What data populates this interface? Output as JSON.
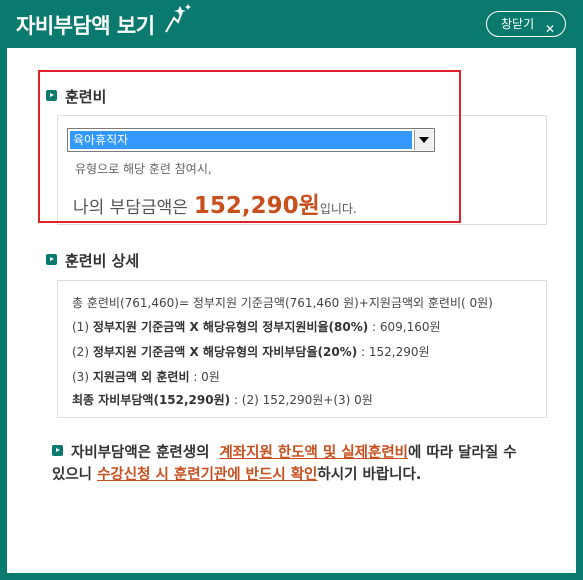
{
  "header": {
    "title": "자비부담액 보기",
    "close_label": "창닫기",
    "close_glyph": "✕"
  },
  "colors": {
    "brand": "#0b7a6e",
    "accent": "#c8501e",
    "highlight_border": "#e0232a",
    "select_bg": "#3399ff"
  },
  "training_fee": {
    "heading": "훈련비",
    "select_value": "육아휴직자",
    "hint": "유형으로 해당 훈련 참여시,",
    "amount_prefix": "나의 부담금액은",
    "amount_value": "152,290원",
    "amount_suffix": "입니다."
  },
  "details": {
    "heading": "훈련비 상세",
    "line1": "총 훈련비(761,460)= 정부지원 기준금액(761,460 원)+지원금액외 훈련비( 0원)",
    "line2_pre": "(1) ",
    "line2_bold": "정부지원 기준금액 X 해당유형의 정부지원비율(80%)",
    "line2_post": " : 609,160원",
    "line3_pre": "(2) ",
    "line3_bold": "정부지원 기준금액 X 해당유형의 자비부담율(20%)",
    "line3_post": " : 152,290원",
    "line4_pre": "(3) ",
    "line4_bold": "지원금액 외 훈련비",
    "line4_post": " : 0원",
    "line5_bold": "최종 자비부담액(152,290원)",
    "line5_post": " : (2) 152,290원+(3) 0원"
  },
  "note": {
    "part1": "자비부담액은 훈련생의",
    "hl1": "계좌지원 한도액 및 실제훈련비",
    "part2": "에 따라 달라질 수 있으니",
    "hl2": "수강신청 시 훈련기관에 반드시 확인",
    "part3": "하시기 바랍니다."
  }
}
